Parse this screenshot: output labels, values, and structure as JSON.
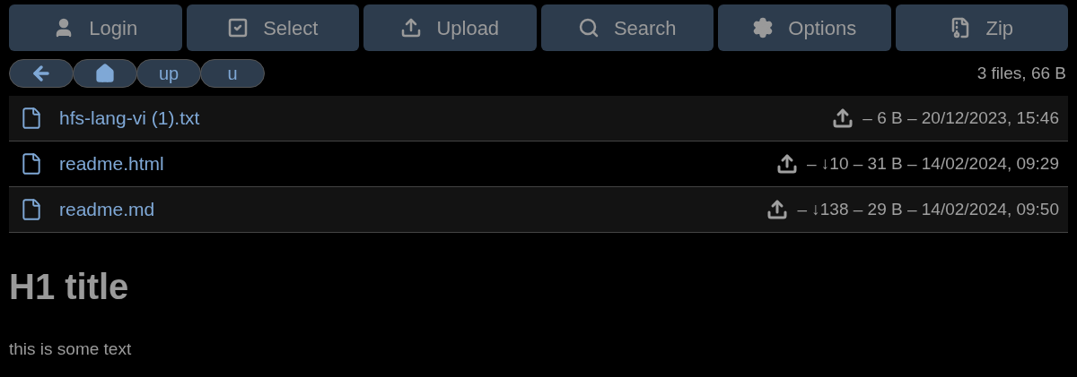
{
  "toolbar": [
    {
      "kind": "login",
      "label": "Login"
    },
    {
      "kind": "select",
      "label": "Select"
    },
    {
      "kind": "upload",
      "label": "Upload"
    },
    {
      "kind": "search",
      "label": "Search"
    },
    {
      "kind": "options",
      "label": "Options"
    },
    {
      "kind": "zip",
      "label": "Zip"
    }
  ],
  "breadcrumbs": [
    {
      "kind": "back"
    },
    {
      "kind": "home"
    },
    {
      "kind": "folder",
      "label": "up"
    },
    {
      "kind": "folder",
      "label": "u"
    }
  ],
  "summary": "3 files, 66 B",
  "files": [
    {
      "name": "hfs-lang-vi (1).txt",
      "details": "– 6 B – 20/12/2023, 15:46"
    },
    {
      "name": "readme.html",
      "details": "– ↓10 – 31 B – 14/02/2024, 09:29"
    },
    {
      "name": "readme.md",
      "details": "– ↓138 – 29 B – 14/02/2024, 09:50"
    }
  ],
  "readme": {
    "heading": "H1 title",
    "text": "this is some text"
  }
}
